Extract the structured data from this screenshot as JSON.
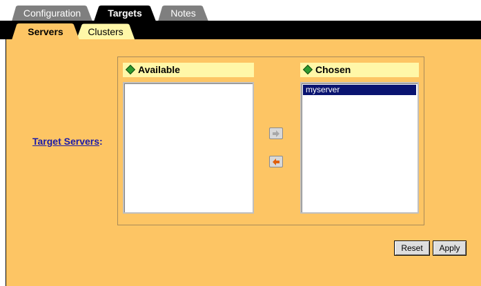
{
  "tabs": [
    {
      "label": "Configuration",
      "active": false
    },
    {
      "label": "Targets",
      "active": true
    },
    {
      "label": "Notes",
      "active": false
    }
  ],
  "subtabs": [
    {
      "label": "Servers",
      "active": true
    },
    {
      "label": "Clusters",
      "active": false
    }
  ],
  "target": {
    "link_label": "Target Servers",
    "suffix": ":"
  },
  "available": {
    "header": "Available",
    "items": []
  },
  "chosen": {
    "header": "Chosen",
    "items": [
      "myserver"
    ],
    "selected": "myserver"
  },
  "buttons": {
    "reset": "Reset",
    "apply": "Apply"
  },
  "colors": {
    "panel": "#fdc564",
    "header_bg": "#fff7a8",
    "tab_inactive": "#7f7f7f",
    "tab_active": "#000000",
    "selection": "#0a1470",
    "link": "#1a1aa8"
  }
}
